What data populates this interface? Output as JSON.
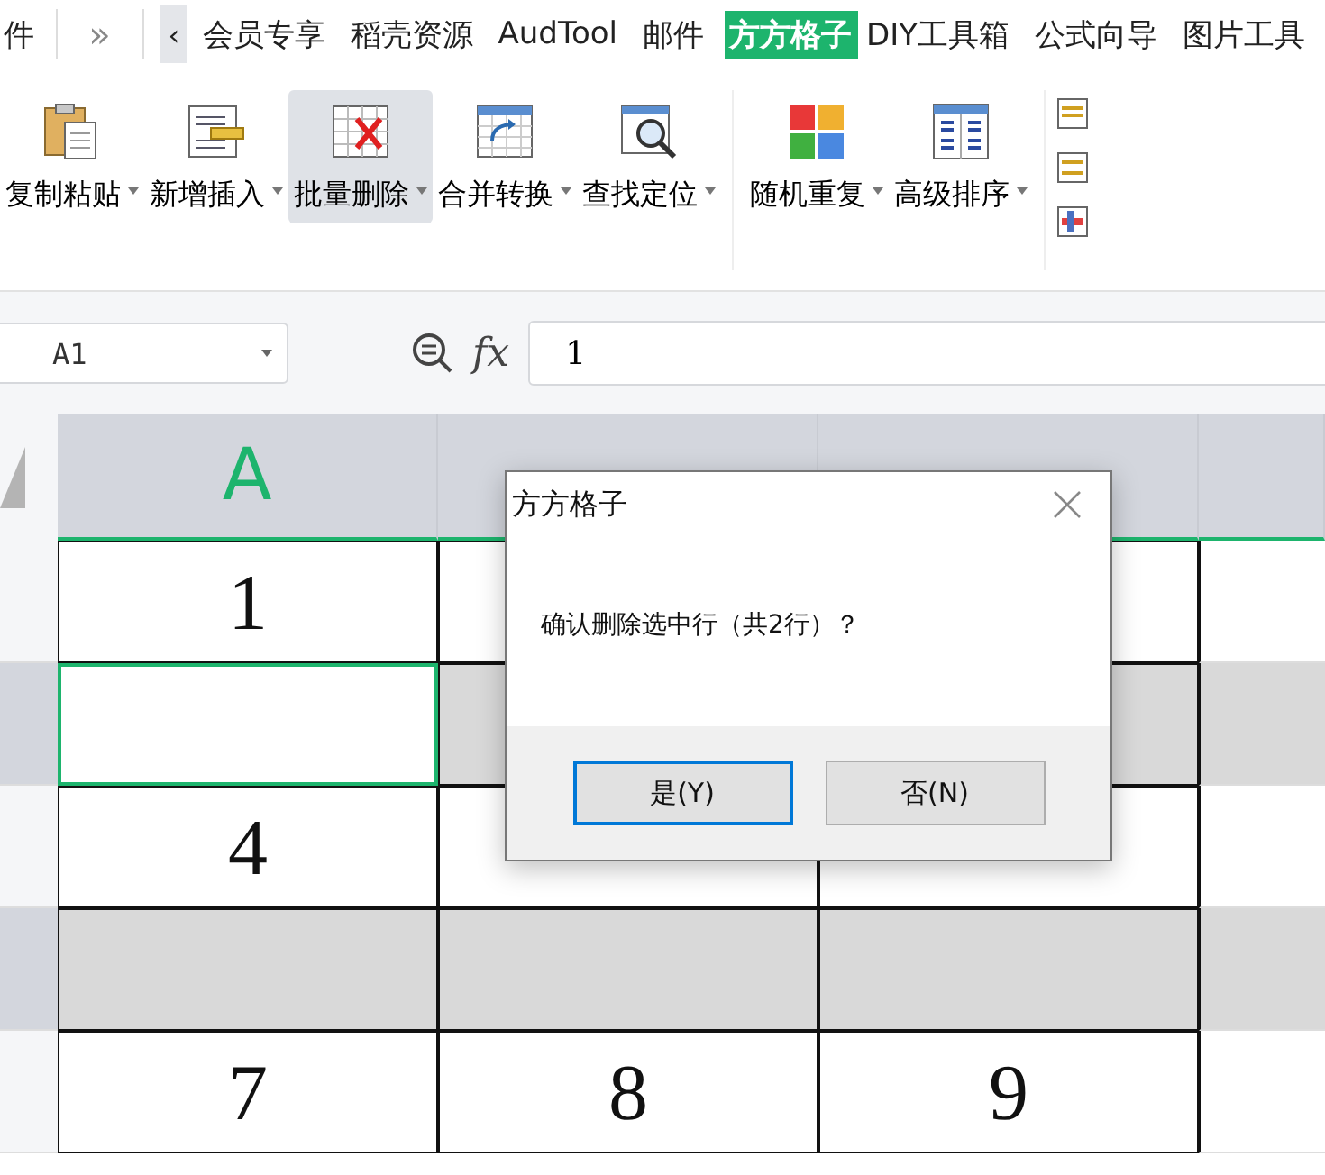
{
  "tab_bar": {
    "cut_tab": "件",
    "more_button": "»",
    "scroll_button": "‹",
    "tabs": [
      {
        "label": "会员专享",
        "selected": false
      },
      {
        "label": "稻壳资源",
        "selected": false
      },
      {
        "label": "AudTool",
        "selected": false
      },
      {
        "label": "邮件",
        "selected": false
      },
      {
        "label": "方方格子",
        "selected": true
      },
      {
        "label": "DIY工具箱",
        "selected": false
      },
      {
        "label": "公式向导",
        "selected": false
      },
      {
        "label": "图片工具",
        "selected": false
      }
    ]
  },
  "ribbon": {
    "groups": [
      {
        "buttons": [
          {
            "label": "复制粘贴",
            "kind": "clipboard",
            "pressed": false
          },
          {
            "label": "新增插入",
            "kind": "insert",
            "pressed": false
          },
          {
            "label": "批量删除",
            "kind": "delete",
            "pressed": true
          },
          {
            "label": "合并转换",
            "kind": "merge",
            "pressed": false
          },
          {
            "label": "查找定位",
            "kind": "find",
            "pressed": false
          }
        ]
      },
      {
        "buttons": [
          {
            "label": "随机重复",
            "kind": "tiles",
            "pressed": false
          },
          {
            "label": "高级排序",
            "kind": "sort",
            "pressed": false
          }
        ]
      }
    ]
  },
  "formula_bar": {
    "name_box": "A1",
    "formula_label": "fx",
    "formula": "1"
  },
  "sheet": {
    "columns": [
      "A"
    ],
    "rows": [
      {
        "selected": false,
        "active_cell_a": false,
        "cells": [
          "1"
        ]
      },
      {
        "selected": true,
        "active_cell_a": true
      },
      {
        "selected": false,
        "active_cell_a": false,
        "cells": [
          "4"
        ]
      },
      {
        "selected": true,
        "active_cell_a": false
      },
      {
        "selected": false,
        "active_cell_a": false,
        "cells": [
          "7",
          "8",
          "9"
        ]
      }
    ]
  },
  "dialog": {
    "title": "方方格子",
    "message": "确认删除选中行（共2行）？",
    "buttons": [
      {
        "label": "是(Y)",
        "focused": true
      },
      {
        "label": "否(N)",
        "focused": false
      }
    ]
  }
}
